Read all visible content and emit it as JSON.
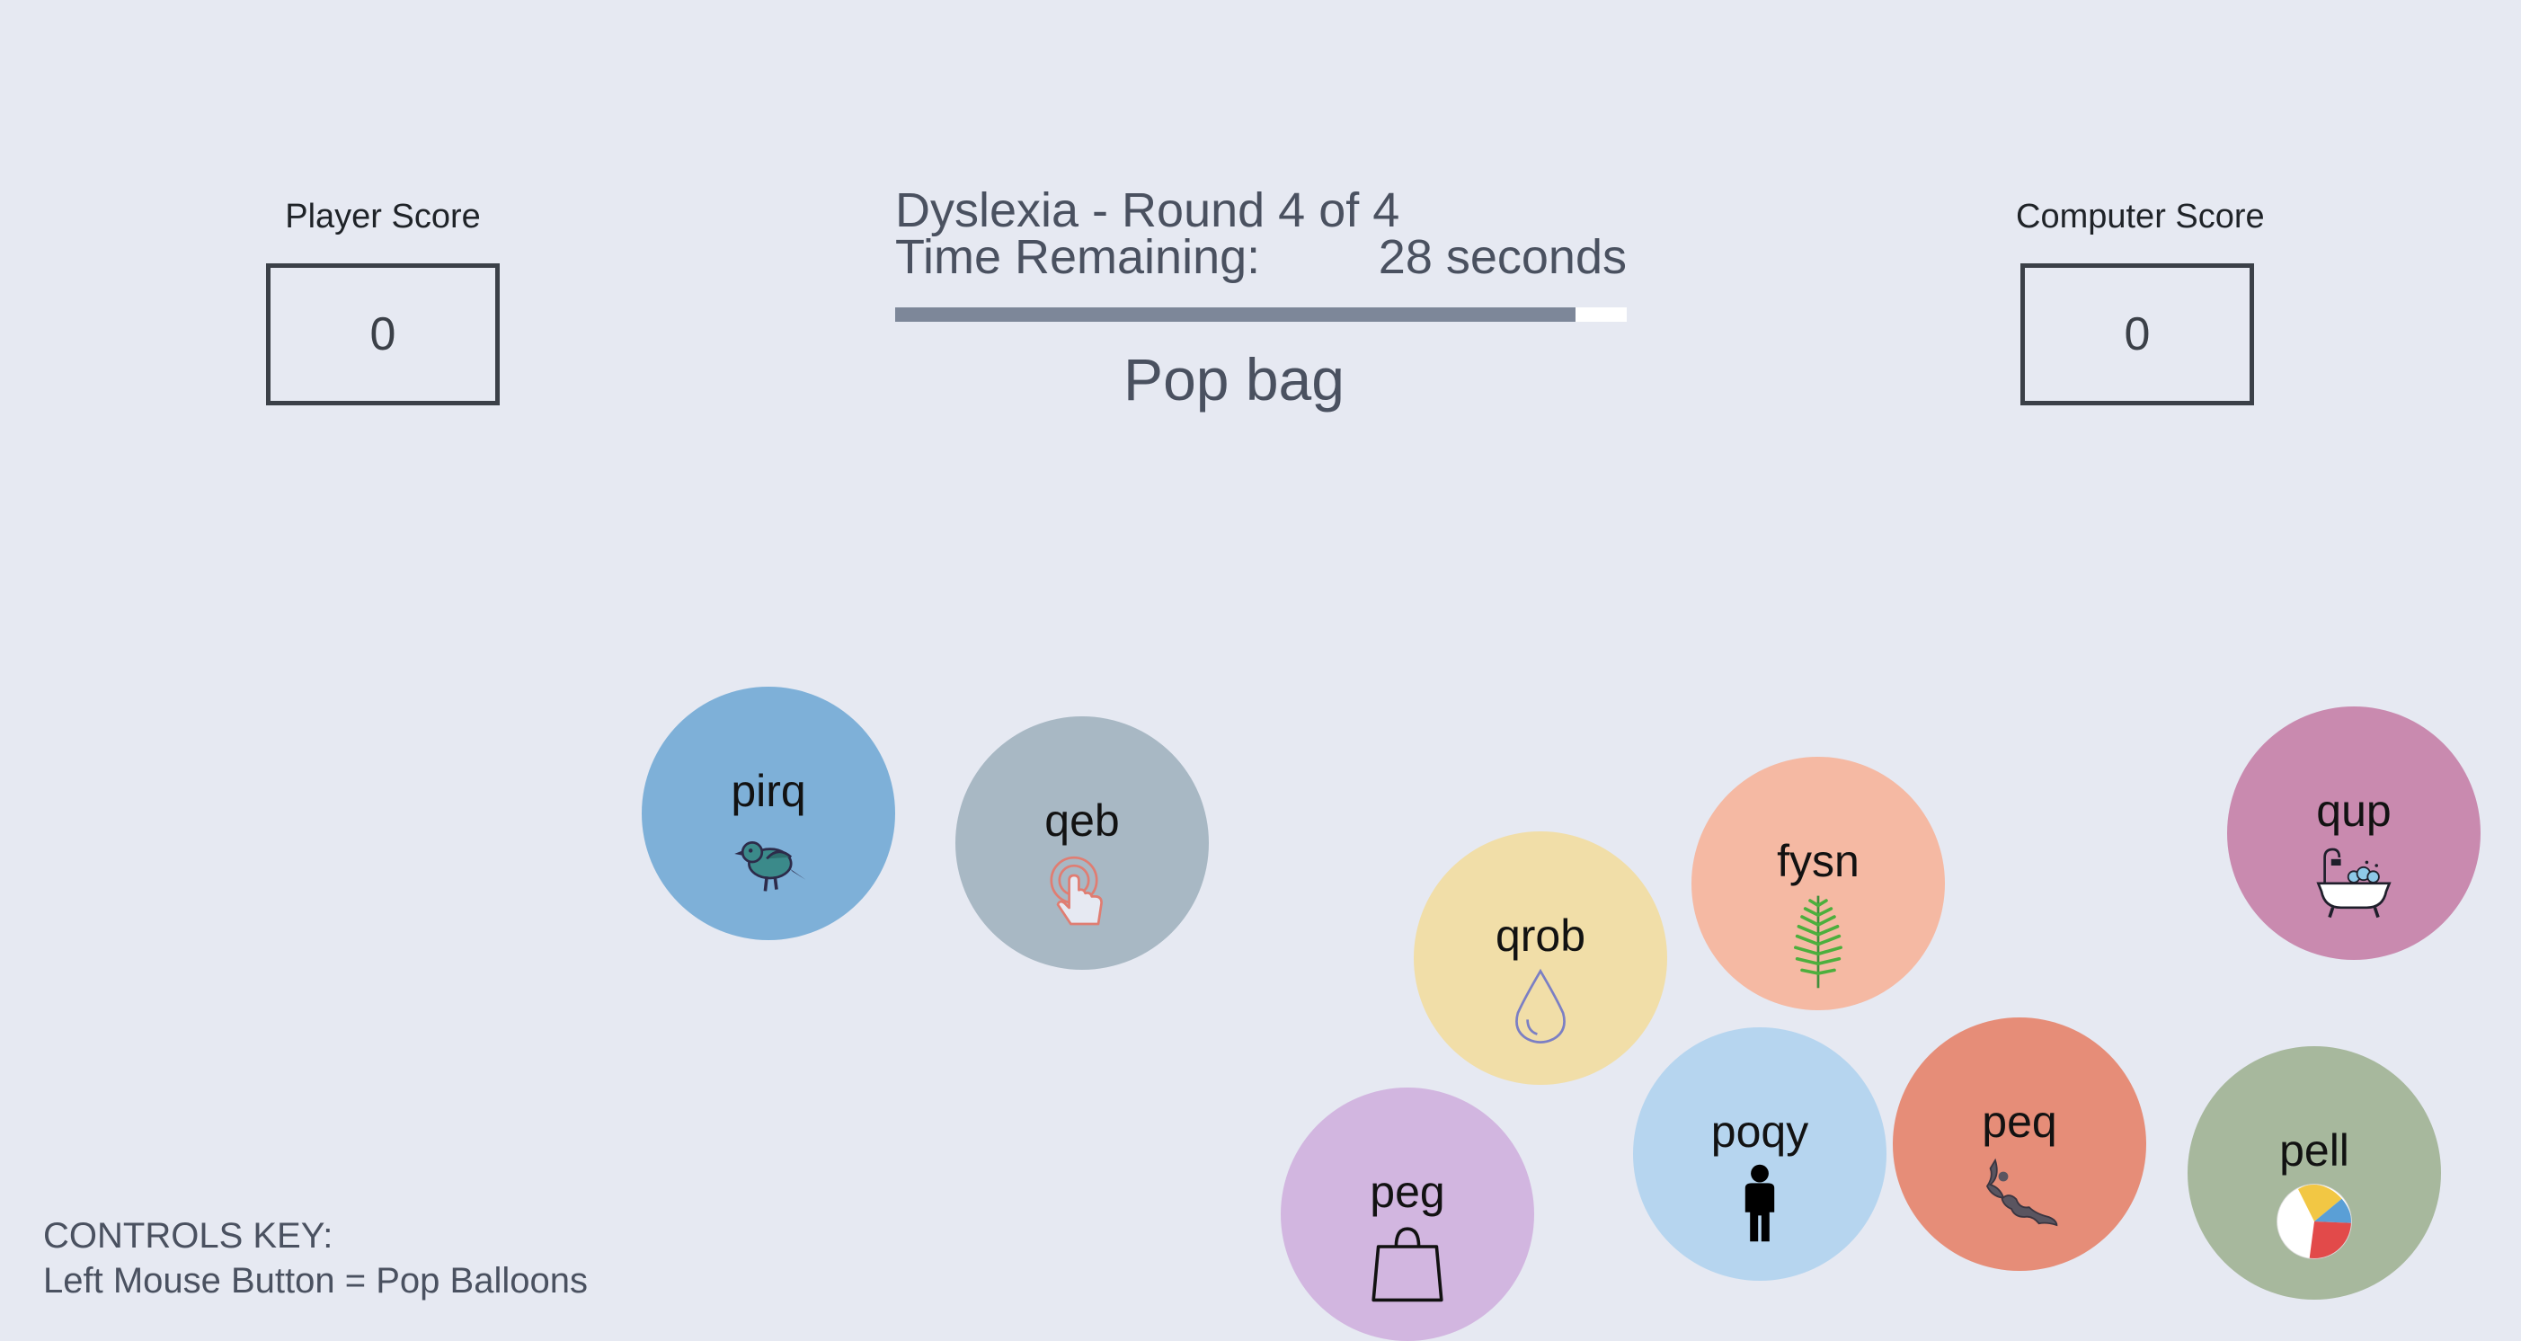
{
  "player_score": {
    "label": "Player Score",
    "value": "0"
  },
  "computer_score": {
    "label": "Computer Score",
    "value": "0"
  },
  "header": {
    "round_title": "Dyslexia - Round 4 of 4",
    "time_label": "Time Remaining:",
    "time_value": "28 seconds",
    "time_fraction": 0.93,
    "prompt": "Pop bag"
  },
  "balloons": [
    {
      "label": "pirq",
      "icon": "bird-icon",
      "color": "#7eb0d8"
    },
    {
      "label": "qeb",
      "icon": "tap-finger-icon",
      "color": "#a8b8c4"
    },
    {
      "label": "qrob",
      "icon": "water-drop-icon",
      "color": "#f1dea8"
    },
    {
      "label": "fysn",
      "icon": "fern-icon",
      "color": "#f5b9a3"
    },
    {
      "label": "qup",
      "icon": "bathtub-icon",
      "color": "#c98aaf"
    },
    {
      "label": "peg",
      "icon": "shopping-bag-icon",
      "color": "#d2b6e0"
    },
    {
      "label": "poqy",
      "icon": "person-icon",
      "color": "#b6d5ef"
    },
    {
      "label": "peq",
      "icon": "bat-icon",
      "color": "#e68d78"
    },
    {
      "label": "pell",
      "icon": "beach-ball-icon",
      "color": "#a7b89d"
    }
  ],
  "controls": {
    "title": "CONTROLS KEY:",
    "line1": "Left Mouse Button = Pop Balloons"
  }
}
